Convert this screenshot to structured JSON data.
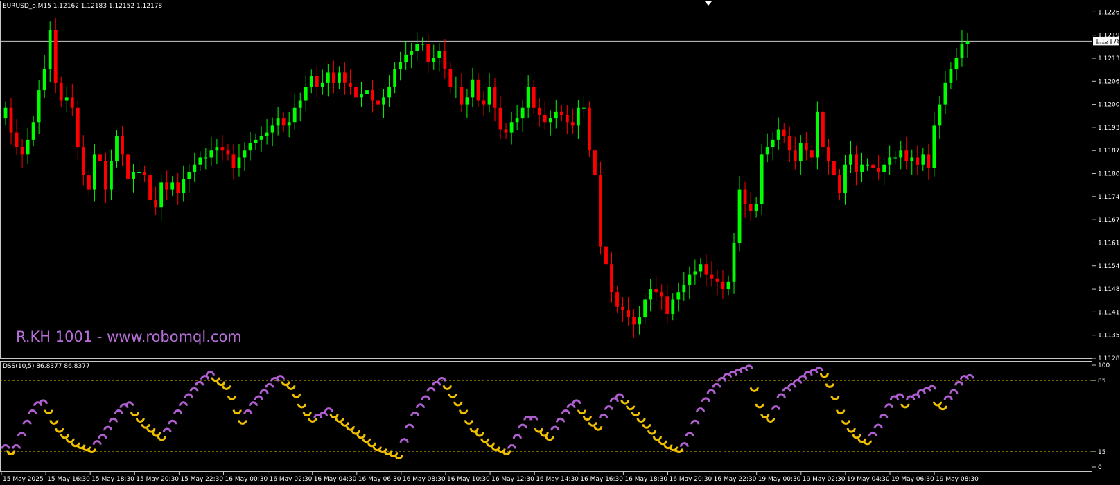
{
  "header": {
    "symbol_line": "EURUSD_o,M15  1.12162 1.12183 1.12152 1.12178"
  },
  "watermark": "R.KH 1001 - www.robomql.com",
  "indicator": {
    "label": "DSS(10,5) 86.8377 86.8377"
  },
  "colors": {
    "bull": "#00ff00",
    "bear": "#ff0000",
    "dss_up": "#b05fd0",
    "dss_down": "#f0c000",
    "level": "#f0c000"
  },
  "chart_data": [
    {
      "type": "candlestick",
      "title": "EURUSD_o,M15",
      "current_price": 1.12178,
      "ylim": [
        1.11285,
        1.1229
      ],
      "y_ticks": [
        "1.12260",
        "1.12195",
        "1.12178",
        "1.12130",
        "1.12065",
        "1.12000",
        "1.11935",
        "1.11870",
        "1.11805",
        "1.11740",
        "1.11675",
        "1.11610",
        "1.11545",
        "1.11480",
        "1.11415",
        "1.11350",
        "1.11285"
      ],
      "x_ticks": [
        "15 May 2025",
        "15 May 16:30",
        "15 May 18:30",
        "15 May 20:30",
        "15 May 22:30",
        "16 May 00:30",
        "16 May 02:30",
        "16 May 04:30",
        "16 May 06:30",
        "16 May 08:30",
        "16 May 10:30",
        "16 May 12:30",
        "16 May 14:30",
        "16 May 16:30",
        "16 May 18:30",
        "16 May 20:30",
        "16 May 22:30",
        "19 May 00:30",
        "19 May 02:30",
        "19 May 04:30",
        "19 May 06:30",
        "19 May 08:30"
      ],
      "ohlc_close": [
        1.1199,
        1.1192,
        1.1188,
        1.1186,
        1.119,
        1.1195,
        1.1204,
        1.121,
        1.1221,
        1.1206,
        1.1201,
        1.1202,
        1.1199,
        1.1188,
        1.118,
        1.1176,
        1.1186,
        1.1184,
        1.1176,
        1.1184,
        1.1191,
        1.1186,
        1.1179,
        1.1181,
        1.1181,
        1.118,
        1.1173,
        1.1171,
        1.1178,
        1.1176,
        1.1178,
        1.1175,
        1.1179,
        1.1181,
        1.1183,
        1.1185,
        1.1185,
        1.1187,
        1.1188,
        1.1187,
        1.1186,
        1.1182,
        1.1185,
        1.1187,
        1.1189,
        1.119,
        1.1191,
        1.1192,
        1.1194,
        1.1196,
        1.1194,
        1.1195,
        1.1199,
        1.1201,
        1.1205,
        1.1208,
        1.1205,
        1.1206,
        1.1209,
        1.1206,
        1.1209,
        1.1206,
        1.1205,
        1.1202,
        1.1203,
        1.1204,
        1.1201,
        1.12,
        1.1202,
        1.1205,
        1.121,
        1.1212,
        1.1214,
        1.1215,
        1.1217,
        1.1217,
        1.1212,
        1.1213,
        1.1215,
        1.121,
        1.1205,
        1.1205,
        1.12,
        1.1202,
        1.1207,
        1.1201,
        1.12,
        1.1205,
        1.1199,
        1.1193,
        1.1192,
        1.1195,
        1.1196,
        1.1199,
        1.1205,
        1.1199,
        1.1197,
        1.1195,
        1.1196,
        1.1198,
        1.1197,
        1.1195,
        1.1194,
        1.1199,
        1.1199,
        1.1187,
        1.118,
        1.116,
        1.1155,
        1.1147,
        1.1143,
        1.1142,
        1.114,
        1.1138,
        1.114,
        1.1145,
        1.1148,
        1.1147,
        1.1146,
        1.1141,
        1.1145,
        1.1147,
        1.1149,
        1.1152,
        1.1153,
        1.1155,
        1.1152,
        1.1151,
        1.115,
        1.1148,
        1.115,
        1.1161,
        1.1176,
        1.1172,
        1.117,
        1.1172,
        1.1186,
        1.1188,
        1.119,
        1.1193,
        1.1191,
        1.1187,
        1.1184,
        1.1189,
        1.1187,
        1.1185,
        1.1198,
        1.1188,
        1.1184,
        1.118,
        1.1175,
        1.1183,
        1.1186,
        1.1181,
        1.1183,
        1.1183,
        1.1182,
        1.1181,
        1.1183,
        1.1185,
        1.1185,
        1.1187,
        1.1184,
        1.1185,
        1.1183,
        1.1186,
        1.1182,
        1.1194,
        1.12,
        1.1206,
        1.121,
        1.1213,
        1.1217,
        1.12178
      ]
    },
    {
      "type": "line",
      "title": "DSS(10,5)",
      "ylim": [
        0,
        100
      ],
      "levels": [
        15,
        85
      ],
      "y_ticks": [
        "100",
        "85",
        "15",
        "0"
      ],
      "series": [
        {
          "name": "DSS(10,5)",
          "values": [
            18,
            16,
            18,
            30,
            42,
            52,
            60,
            62,
            56,
            46,
            38,
            32,
            28,
            24,
            22,
            20,
            18,
            22,
            28,
            36,
            44,
            52,
            58,
            60,
            54,
            48,
            42,
            38,
            34,
            30,
            34,
            42,
            52,
            60,
            68,
            74,
            80,
            86,
            90,
            88,
            84,
            80,
            70,
            56,
            46,
            52,
            60,
            66,
            72,
            78,
            84,
            86,
            84,
            80,
            72,
            62,
            54,
            48,
            48,
            50,
            54,
            52,
            48,
            44,
            40,
            36,
            32,
            28,
            24,
            20,
            18,
            16,
            14,
            12,
            24,
            38,
            50,
            58,
            66,
            74,
            80,
            84,
            80,
            72,
            64,
            56,
            46,
            38,
            34,
            28,
            24,
            20,
            18,
            16,
            18,
            28,
            38,
            46,
            46,
            38,
            34,
            30,
            36,
            44,
            52,
            58,
            62,
            56,
            50,
            44,
            40,
            48,
            56,
            64,
            68,
            66,
            60,
            54,
            48,
            42,
            36,
            30,
            26,
            22,
            20,
            18,
            20,
            30,
            42,
            54,
            64,
            72,
            78,
            84,
            88,
            90,
            92,
            94,
            96,
            78,
            62,
            52,
            48,
            56,
            68,
            74,
            78,
            82,
            86,
            90,
            92,
            94,
            92,
            82,
            70,
            56,
            46,
            38,
            32,
            28,
            26,
            30,
            38,
            48,
            58,
            66,
            68,
            62,
            66,
            68,
            72,
            74,
            76,
            64,
            60,
            66,
            72,
            80,
            86,
            86.8377
          ]
        }
      ]
    }
  ]
}
